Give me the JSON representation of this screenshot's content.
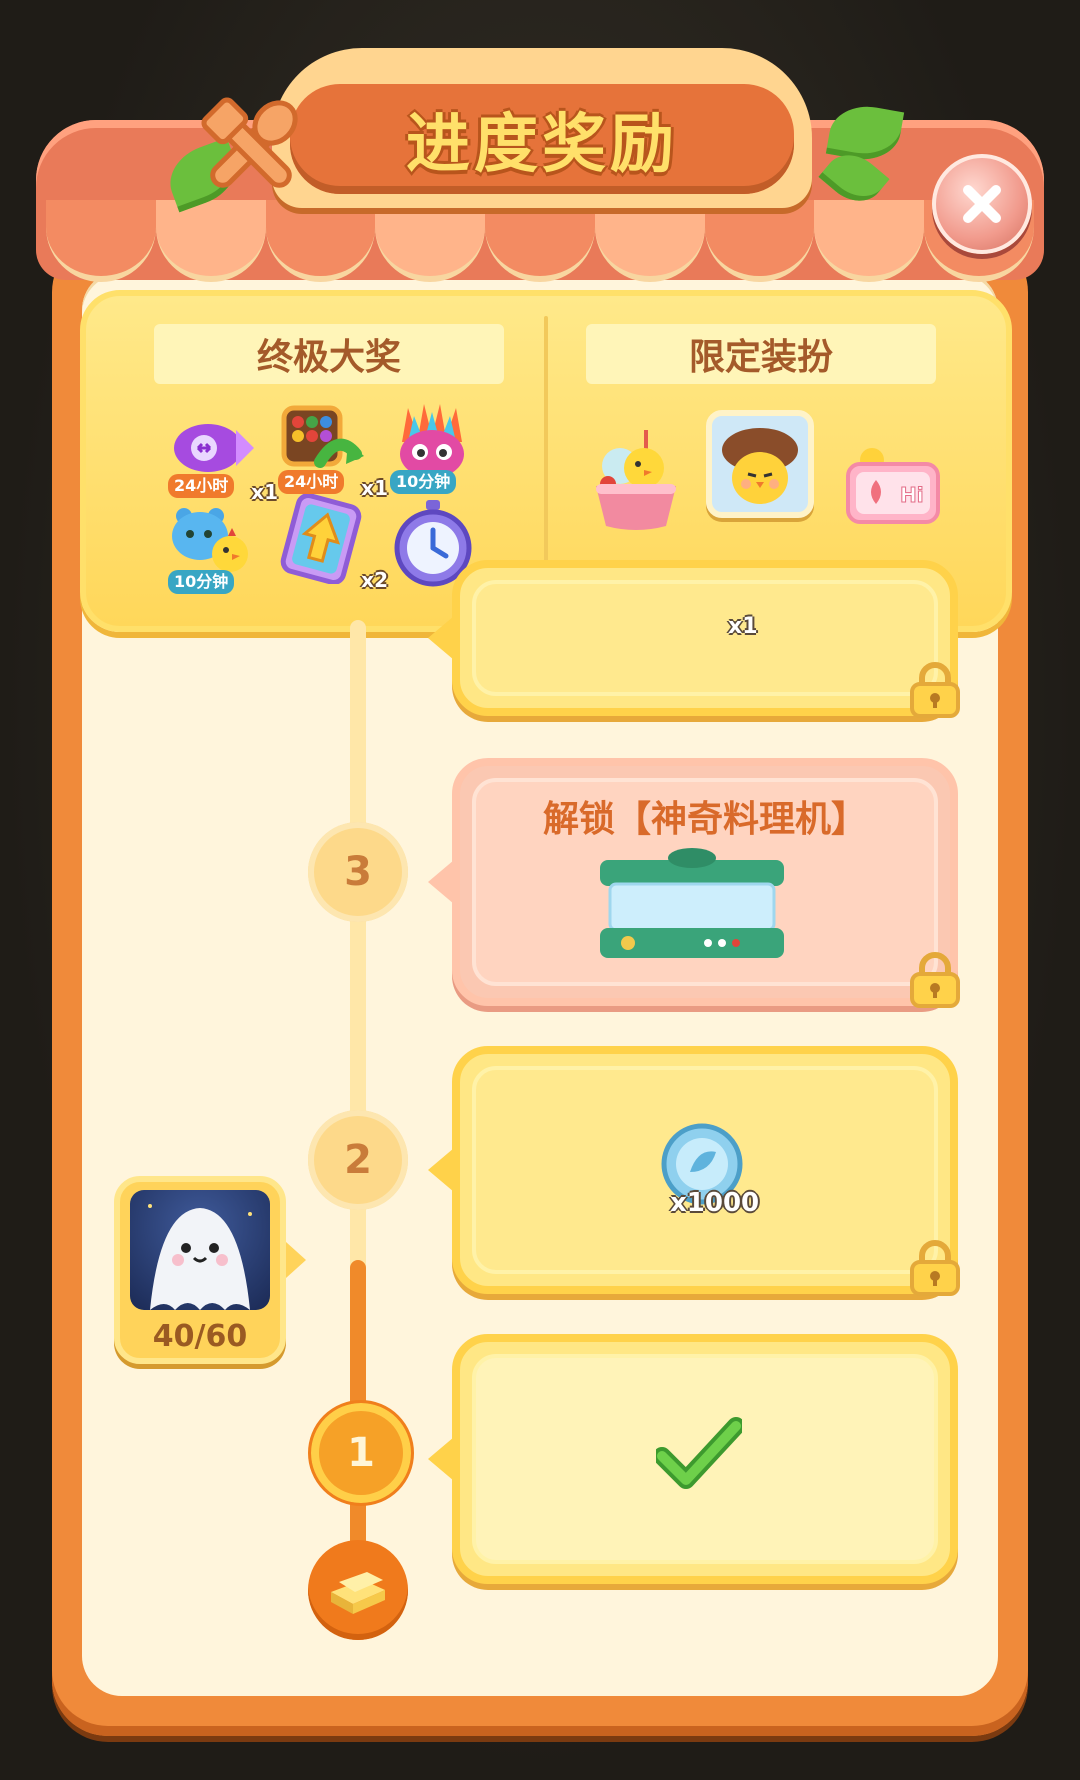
{
  "title": "进度奖励",
  "close_icon": "close-icon",
  "grand_prize": {
    "heading": "终极大奖",
    "items": [
      {
        "icon": "purple-rocket-icon",
        "tag": "24小时",
        "mult": "x1"
      },
      {
        "icon": "candy-board-icon",
        "tag": "24小时",
        "mult": "x1"
      },
      {
        "icon": "rainbow-bird-icon",
        "tag": "10分钟",
        "mult": ""
      },
      {
        "icon": "blue-bear-chick-icon",
        "tag": "10分钟",
        "mult": ""
      },
      {
        "icon": "arrow-card-icon",
        "tag": "",
        "mult": "x2"
      },
      {
        "icon": "stopwatch-icon",
        "tag": "",
        "mult": "x2"
      }
    ]
  },
  "limited_outfit": {
    "heading": "限定装扮",
    "items": [
      "ice-cream-chick-icon",
      "mushroom-chick-avatar-icon",
      "hi-chat-frame-icon"
    ]
  },
  "milestones": [
    {
      "number": "",
      "status": "locked",
      "reward_text": "x1"
    },
    {
      "number": "3",
      "status": "locked",
      "reward_text": "解锁【神奇料理机】"
    },
    {
      "number": "2",
      "status": "locked",
      "reward_text": "x1000"
    },
    {
      "number": "1",
      "status": "claimed",
      "reward_text": ""
    }
  ],
  "player": {
    "progress": "40/60",
    "progress_fraction": 0.667,
    "avatar_icon": "ghost-avatar-icon"
  },
  "start_icon": "gold-bars-icon",
  "colors": {
    "panel_orange": "#f08a3a",
    "card_yellow": "#ffd24a",
    "card_pink": "#ffc4aa",
    "title_yellow": "#ffe06a"
  }
}
